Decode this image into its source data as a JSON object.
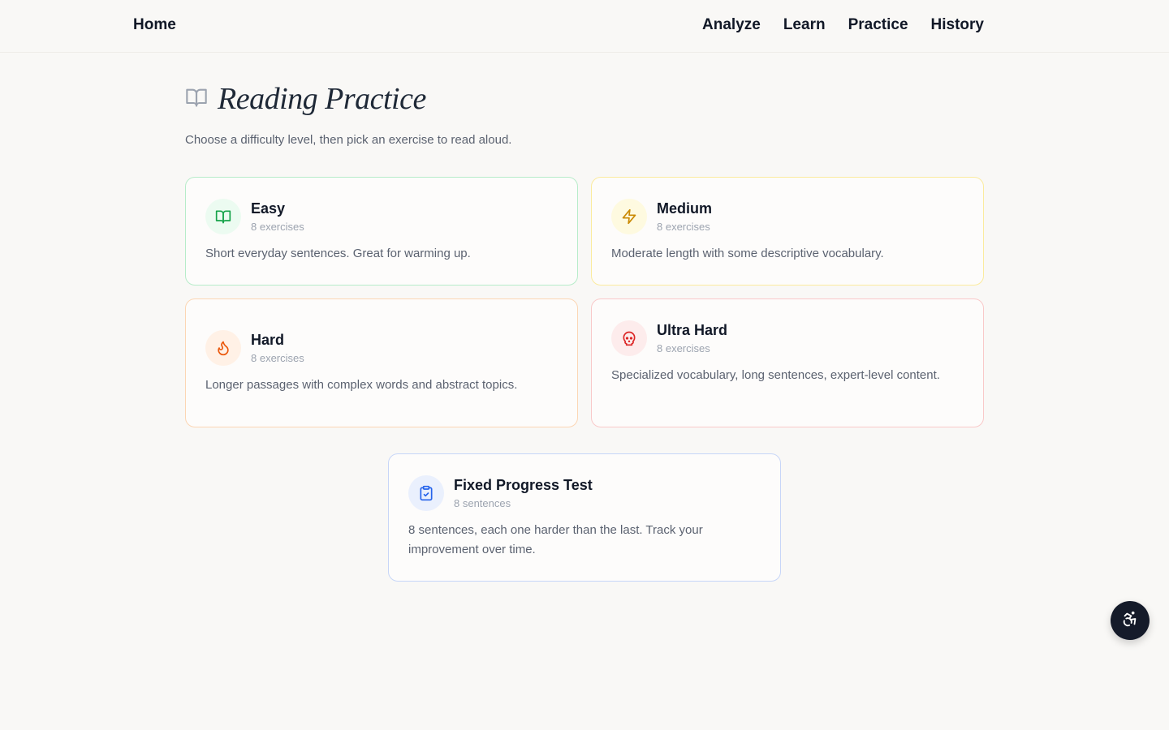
{
  "nav": {
    "home": "Home",
    "links": [
      "Analyze",
      "Learn",
      "Practice",
      "History"
    ]
  },
  "page": {
    "title": "Reading Practice",
    "subtitle": "Choose a difficulty level, then pick an exercise to read aloud."
  },
  "cards": {
    "easy": {
      "name": "Easy",
      "count": "8 exercises",
      "desc": "Short everyday sentences. Great for warming up.",
      "icon": "book-open-icon",
      "accent": "#16a34a",
      "bg": "#ecfbf1"
    },
    "medium": {
      "name": "Medium",
      "count": "8 exercises",
      "desc": "Moderate length with some descriptive vocabulary.",
      "icon": "lightning-icon",
      "accent": "#ca8a04",
      "bg": "#fefae0"
    },
    "hard": {
      "name": "Hard",
      "count": "8 exercises",
      "desc": "Longer passages with complex words and abstract topics.",
      "icon": "flame-icon",
      "accent": "#ea580c",
      "bg": "#fff1e6"
    },
    "ultra": {
      "name": "Ultra Hard",
      "count": "8 exercises",
      "desc": "Specialized vocabulary, long sentences, expert-level content.",
      "icon": "skull-icon",
      "accent": "#dc2626",
      "bg": "#fdecec"
    },
    "fixed": {
      "name": "Fixed Progress Test",
      "count": "8 sentences",
      "desc": "8 sentences, each one harder than the last. Track your improvement over time.",
      "icon": "clipboard-check-icon",
      "accent": "#2563eb",
      "bg": "#eaf0fd"
    }
  },
  "accessibility_button_icon": "accessibility-icon"
}
